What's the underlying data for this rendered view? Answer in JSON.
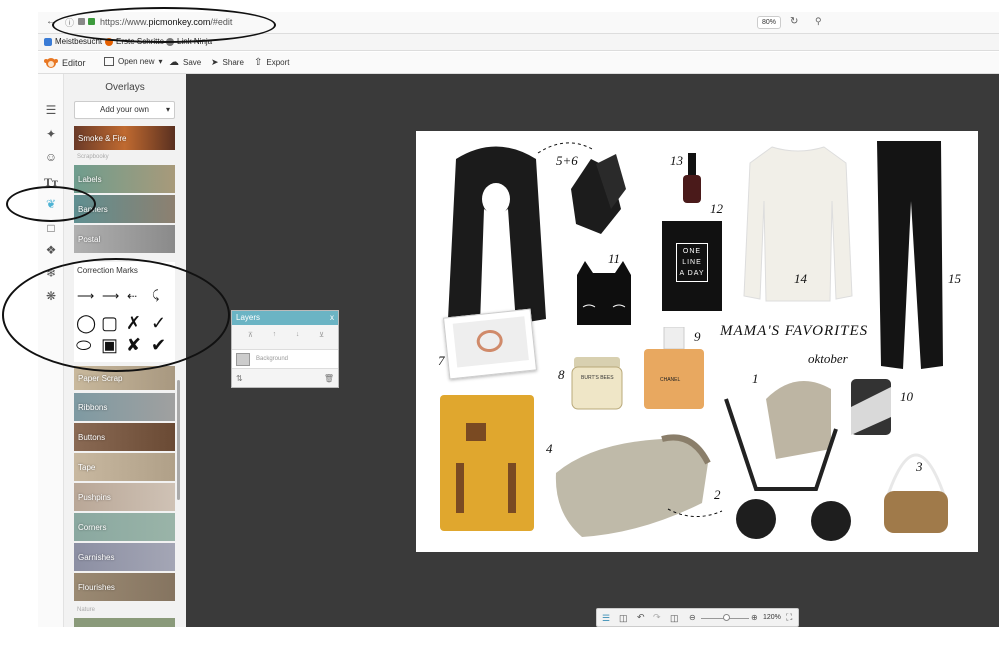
{
  "browser": {
    "url_prefix": "https://www.",
    "url_domain": "picmonkey.com",
    "url_suffix": "/#edit",
    "zoom": "80%"
  },
  "bookmarks": [
    {
      "label": "Meistbesucht",
      "color": "#3a7bd5"
    },
    {
      "label": "Erste Schritte",
      "color": "#e66000"
    },
    {
      "label": "Link Ninja",
      "color": "#777777"
    }
  ],
  "toolbar": {
    "app_name": "Editor",
    "open_new": "Open new",
    "save": "Save",
    "share": "Share",
    "export": "Export"
  },
  "panel": {
    "title": "Overlays",
    "add_own": "Add your own",
    "scrapbooky_label": "Scrapbooky",
    "nature_label": "Nature",
    "tiles_top": [
      {
        "label": "Smoke & Fire",
        "color": "#8a5a3a"
      },
      {
        "label": "Labels",
        "color": "#6f9d8e"
      },
      {
        "label": "Banners",
        "color": "#5f8f91"
      },
      {
        "label": "Postal",
        "color": "#a9a9a9"
      }
    ],
    "correction_marks": "Correction Marks",
    "tiles_bottom": [
      {
        "label": "Paper Scrap",
        "color": "#b8a890"
      },
      {
        "label": "Ribbons",
        "color": "#7e9aa2"
      },
      {
        "label": "Buttons",
        "color": "#8a6a54"
      },
      {
        "label": "Tape",
        "color": "#c8b8a0"
      },
      {
        "label": "Pushpins",
        "color": "#b9a797"
      },
      {
        "label": "Corners",
        "color": "#8aa8a0"
      },
      {
        "label": "Garnishes",
        "color": "#8c8fa3"
      },
      {
        "label": "Flourishes",
        "color": "#9b8a73"
      }
    ]
  },
  "layers": {
    "title": "Layers",
    "close": "x",
    "background": "Background"
  },
  "board": {
    "title": "MAMA'S FAVORITES",
    "subtitle": "oktober",
    "numbers": [
      "1",
      "2",
      "3",
      "4",
      "5+6",
      "7",
      "8",
      "9",
      "10",
      "11",
      "12",
      "13",
      "14",
      "15"
    ],
    "book_text": "ONE LINE A DAY",
    "perfume_text": "CHANEL",
    "jar_text": "BURT'S BEES"
  },
  "bottom_bar": {
    "zoom": "120%"
  }
}
